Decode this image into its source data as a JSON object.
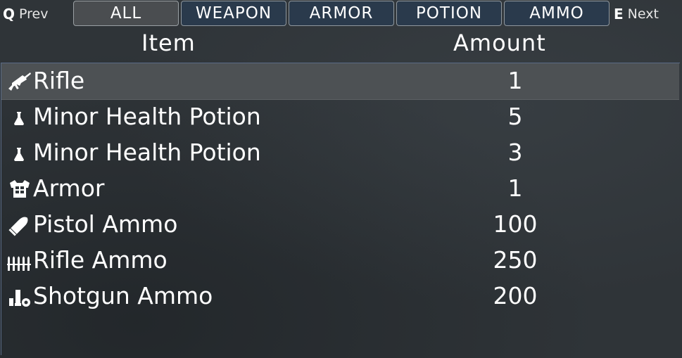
{
  "nav": {
    "prev_key": "Q",
    "prev_label": "Prev",
    "next_key": "E",
    "next_label": "Next",
    "tabs": [
      {
        "label": "ALL",
        "active": true
      },
      {
        "label": "WEAPON",
        "active": false
      },
      {
        "label": "ARMOR",
        "active": false
      },
      {
        "label": "POTION",
        "active": false
      },
      {
        "label": "AMMO",
        "active": false
      }
    ]
  },
  "table": {
    "col_item": "Item",
    "col_amount": "Amount",
    "rows": [
      {
        "icon": "rifle-icon",
        "name": "Rifle",
        "amount": "1",
        "selected": true
      },
      {
        "icon": "potion-flask-icon",
        "name": "Minor Health Potion",
        "amount": "5",
        "selected": false
      },
      {
        "icon": "potion-flask-icon",
        "name": "Minor Health Potion",
        "amount": "3",
        "selected": false
      },
      {
        "icon": "armor-vest-icon",
        "name": "Armor",
        "amount": "1",
        "selected": false
      },
      {
        "icon": "pistol-bullet-icon",
        "name": "Pistol Ammo",
        "amount": "100",
        "selected": false
      },
      {
        "icon": "rifle-bullets-icon",
        "name": "Rifle Ammo",
        "amount": "250",
        "selected": false
      },
      {
        "icon": "shotgun-shells-icon",
        "name": "Shotgun Ammo",
        "amount": "200",
        "selected": false
      }
    ]
  },
  "colors": {
    "background": "#2f3438",
    "tab_inactive": "#2a3a4c",
    "tab_active": "#4a4d50",
    "selected_row": "#4d5154",
    "list_border": "#5a6b86"
  }
}
